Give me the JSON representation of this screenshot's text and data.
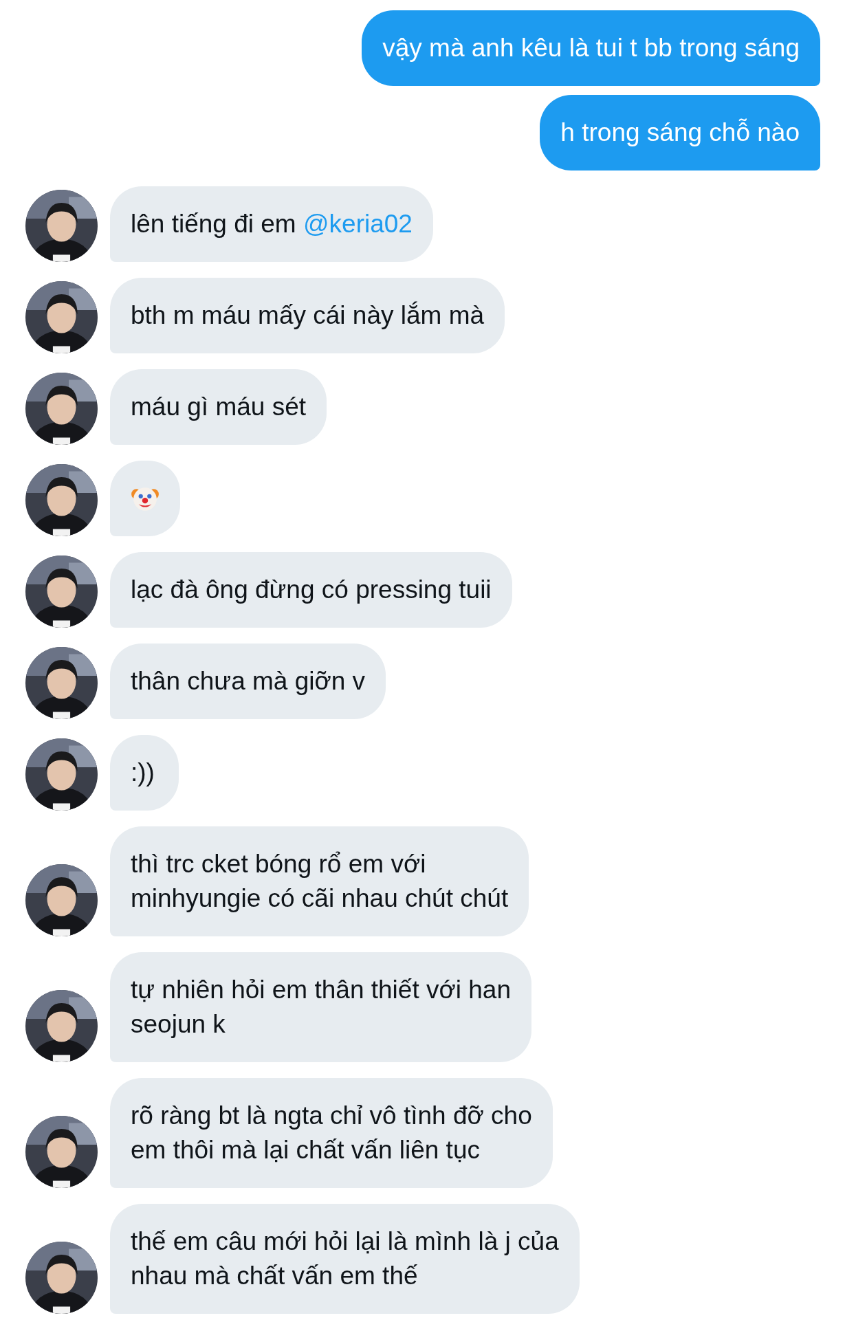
{
  "sent_messages": [
    {
      "lines": [
        "vậy mà anh kêu là tui t bb trong sáng"
      ]
    },
    {
      "lines": [
        "h trong sáng chỗ nào"
      ]
    }
  ],
  "received_messages": [
    {
      "kind": "text",
      "lines": [
        "lên tiếng đi em"
      ],
      "mention": "@keria02"
    },
    {
      "kind": "text",
      "lines": [
        "bth m máu mấy cái này lắm mà"
      ]
    },
    {
      "kind": "text",
      "lines": [
        "máu gì máu sét"
      ]
    },
    {
      "kind": "emoji"
    },
    {
      "kind": "text",
      "lines": [
        "lạc đà ông đừng có pressing tuii"
      ]
    },
    {
      "kind": "text",
      "lines": [
        "thân chưa mà giỡn v"
      ]
    },
    {
      "kind": "text",
      "lines": [
        ":))"
      ]
    },
    {
      "kind": "text",
      "lines": [
        "thì trc cket bóng rổ em với",
        "minhyungie có cãi nhau chút chút"
      ]
    },
    {
      "kind": "text",
      "lines": [
        "tự nhiên hỏi em thân thiết với han",
        "seojun k"
      ]
    },
    {
      "kind": "text",
      "lines": [
        "rõ ràng bt là ngta chỉ vô tình đỡ cho",
        "em thôi mà lại chất vấn liên tục"
      ]
    },
    {
      "kind": "text",
      "lines": [
        "thế em câu mới hỏi lại là mình là j của",
        "nhau mà chất vấn em thế"
      ]
    }
  ]
}
